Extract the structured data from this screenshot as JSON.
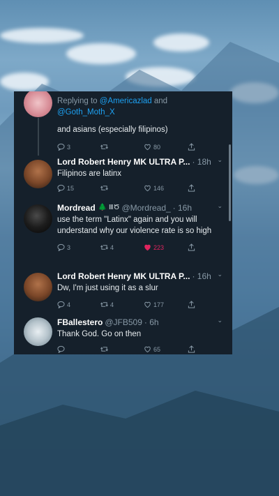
{
  "tweets": [
    {
      "reply_prefix": "Replying to ",
      "reply_user1": "@Americazlad",
      "reply_and": " and",
      "reply_user2": "@Goth_Moth_X",
      "text": "and asians (especially filipinos)",
      "replies": "3",
      "retweets": "",
      "likes": "80"
    },
    {
      "name": "Lord Robert Henry MK ULTRA P...",
      "handle": "",
      "time": "· 18h",
      "text": "Filipinos are latinx",
      "replies": "15",
      "retweets": "",
      "likes": "146"
    },
    {
      "name": "Mordread",
      "name_suffix": "🌲 ⅢԾ",
      "handle": "@Mordread_",
      "time": "· 16h",
      "text": "use the term \"Latinx\" again and you will understand why our violence rate is so high",
      "replies": "3",
      "retweets": "4",
      "likes": "223"
    },
    {
      "name": "Lord Robert Henry MK ULTRA P...",
      "handle": "",
      "time": "· 16h",
      "text": "Dw, I'm just using it as a slur",
      "replies": "4",
      "retweets": "4",
      "likes": "177"
    },
    {
      "name": "FBallestero",
      "handle": "@JFB509",
      "time": "· 6h",
      "text": "Thank God. Go on then",
      "replies": "",
      "retweets": "",
      "likes": "65"
    }
  ],
  "colors": {
    "panel_bg": "#15202b",
    "link": "#1da1f2",
    "muted": "#8899a6",
    "like_active": "#e0245e"
  }
}
